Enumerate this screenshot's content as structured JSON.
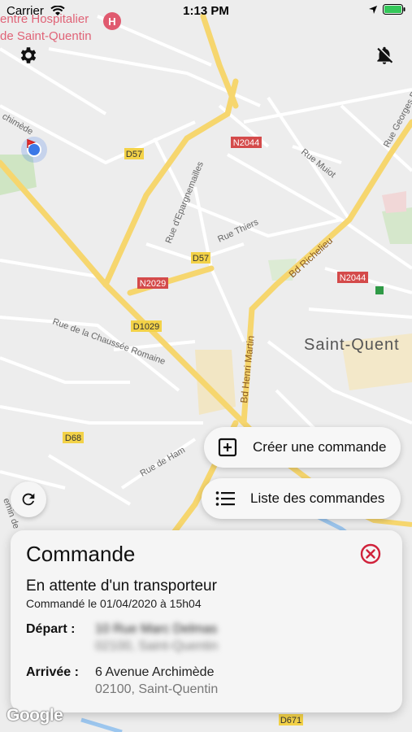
{
  "status_bar": {
    "carrier": "Carrier",
    "time": "1:13 PM"
  },
  "map": {
    "labels": {
      "hospital_line1": "entre Hospitalier",
      "hospital_line2": "de Saint-Quentin",
      "archimede": "chimède",
      "d57_a": "D57",
      "d57_b": "D57",
      "n2044_a": "N2044",
      "n2044_b": "N2044",
      "n2029": "N2029",
      "d1029": "D1029",
      "d68": "D68",
      "d671": "D671",
      "rue_muiot": "Rue Muiot",
      "rue_georges": "Rue Georges Pompidou",
      "rue_epargnemailles": "Rue d'Epargnemailles",
      "rue_thiers": "Rue Thiers",
      "bd_richelieu": "Bd Richelieu",
      "bd_henri_martin": "Bd Henri Martin",
      "rue_chaussee": "Rue de la Chaussée Romaine",
      "rue_de_ham": "Rue de Ham",
      "chemin": "emin de",
      "city": "Saint-Quent"
    },
    "attribution": "Google"
  },
  "buttons": {
    "create_order": "Créer une commande",
    "order_list": "Liste des commandes"
  },
  "order_card": {
    "title": "Commande",
    "status": "En attente d'un transporteur",
    "ordered_at": "Commandé le 01/04/2020 à 15h04",
    "departure_label": "Départ :",
    "departure_line1": "10 Rue Marc Delmas",
    "departure_line2": "02100, Saint-Quentin",
    "arrival_label": "Arrivée :",
    "arrival_line1": "6 Avenue Archimède",
    "arrival_line2": "02100, Saint-Quentin"
  },
  "colors": {
    "accent_red": "#d0213a",
    "road_major": "#f6d66e",
    "road_badge_red": "#d44a4a",
    "road_badge_yellow": "#f3d248",
    "location_blue": "#3b78e7"
  }
}
